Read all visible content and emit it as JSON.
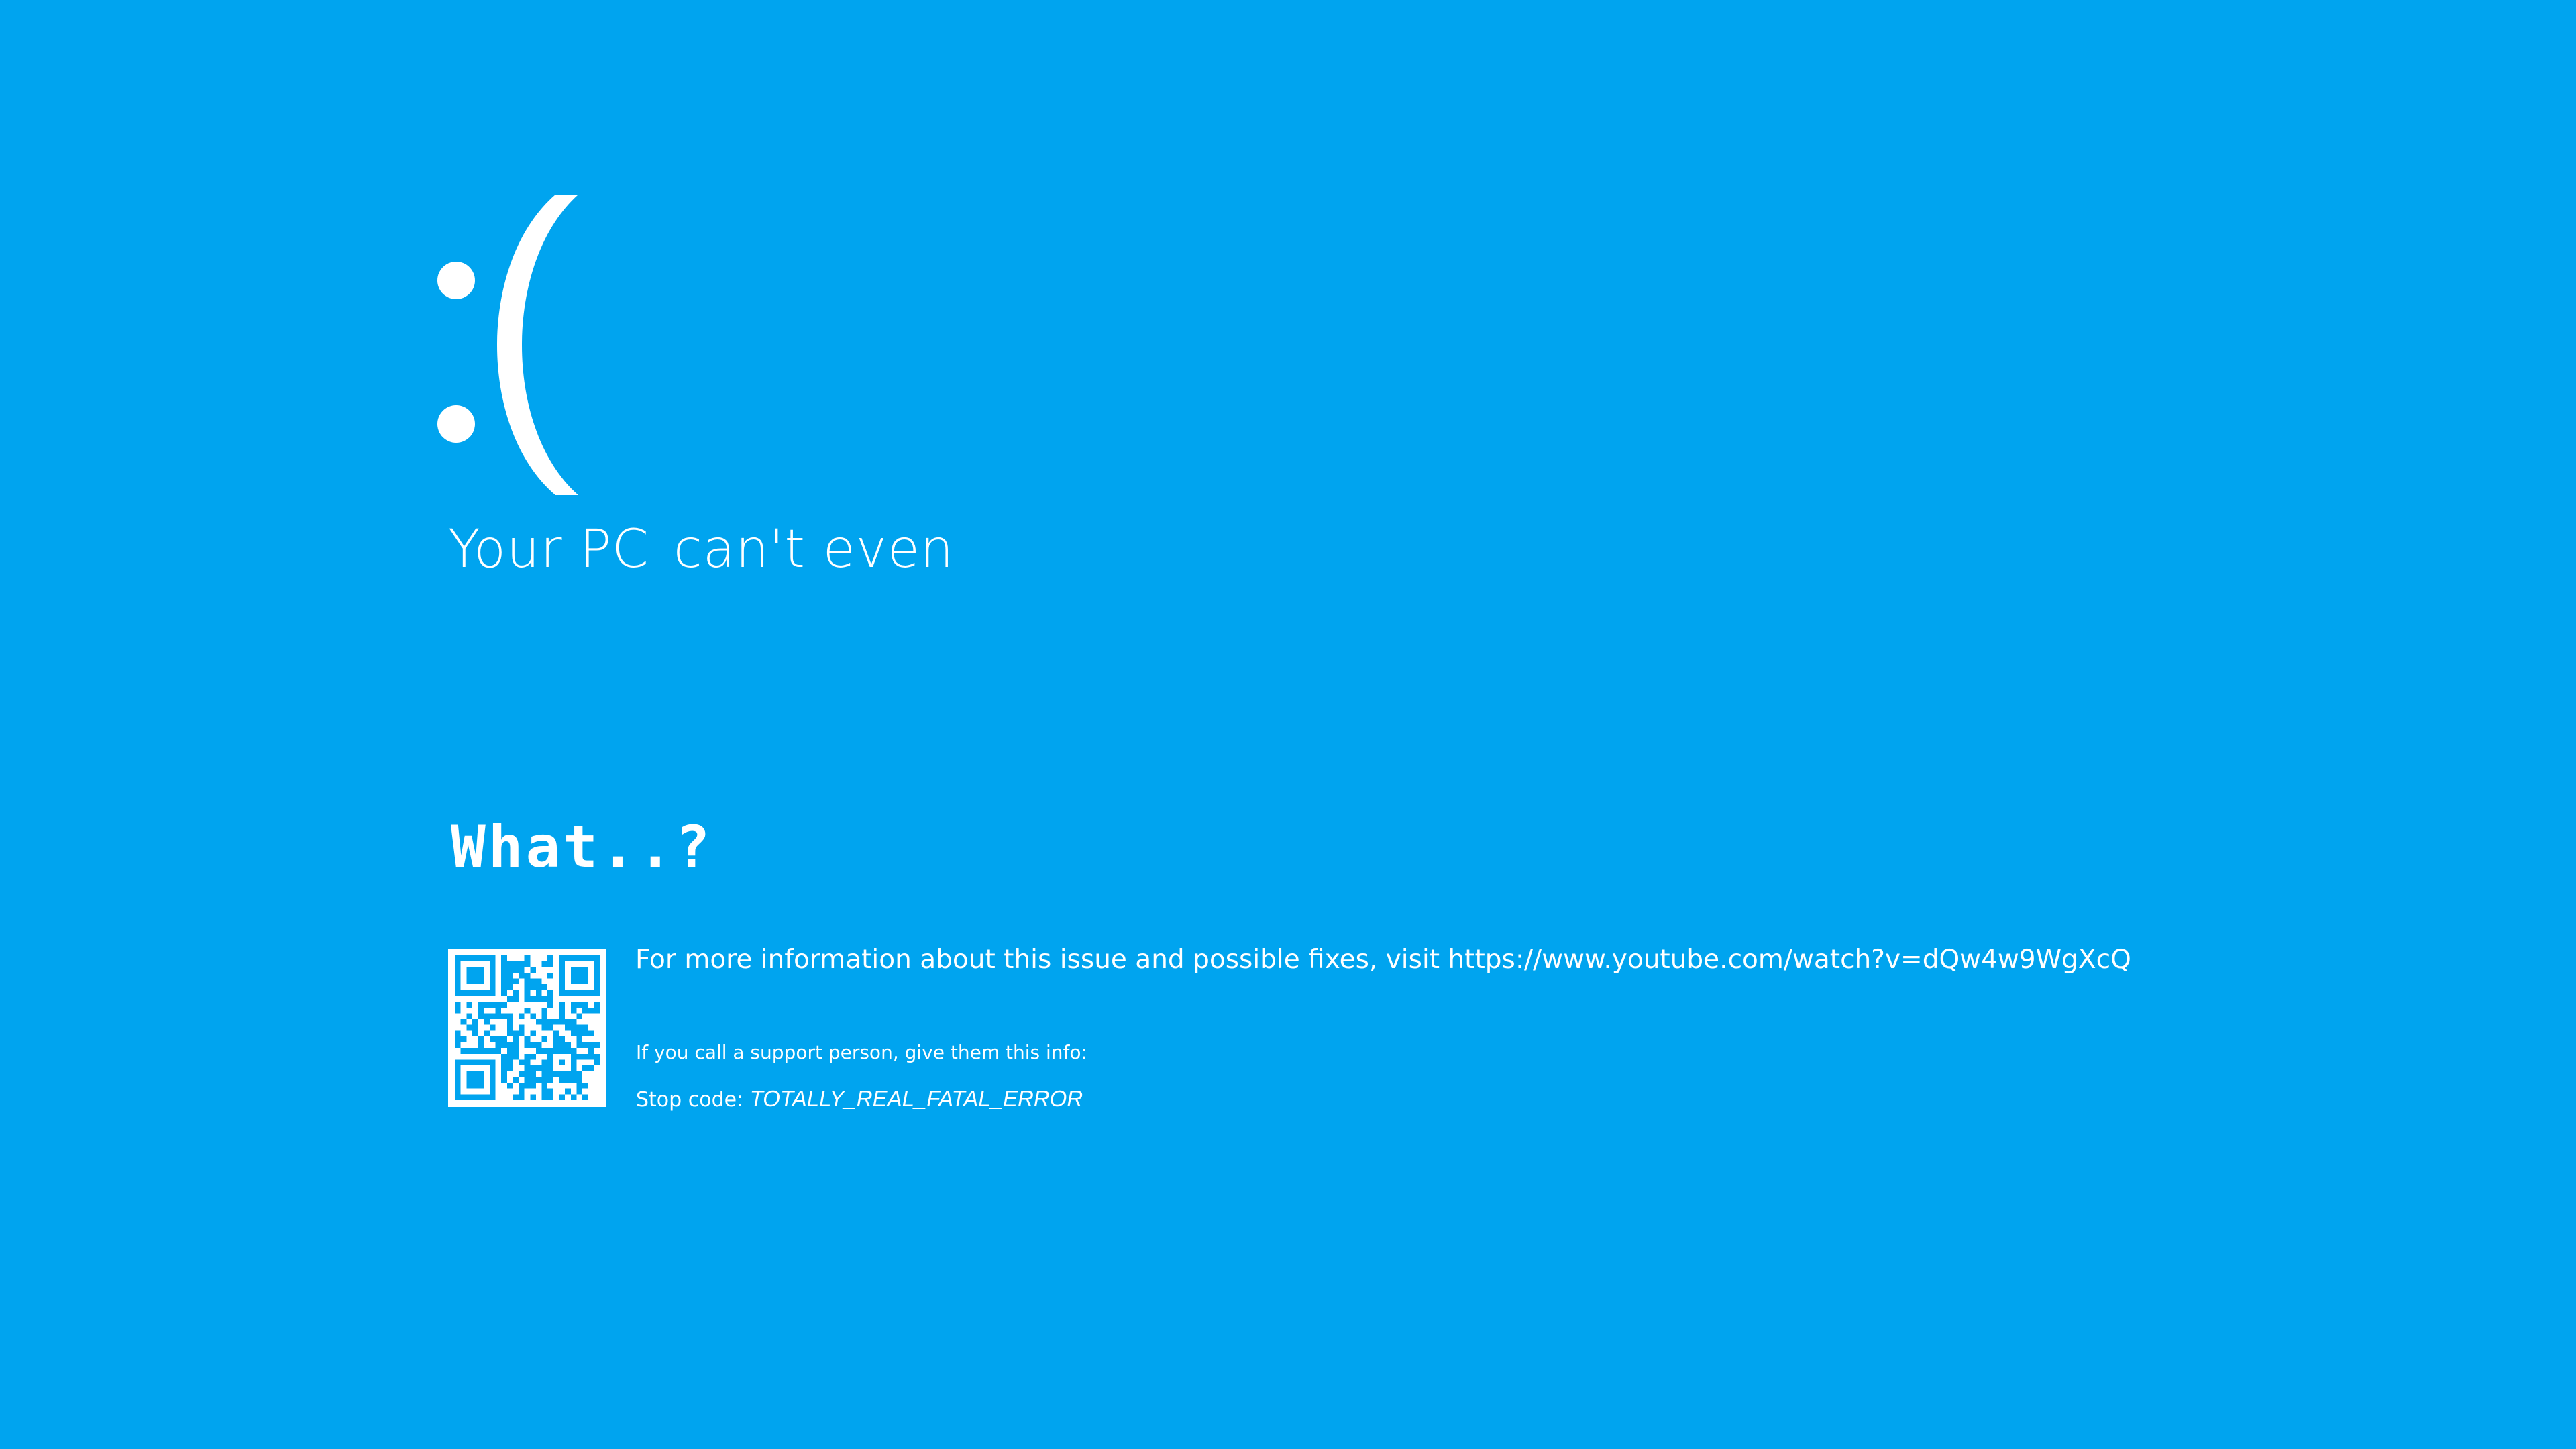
{
  "screen": {
    "background_color": "#00a4ef",
    "text_color": "#ffffff"
  },
  "face": {
    "icon": "sad-face-emoticon",
    "text": ":("
  },
  "headline": {
    "part1": "Your PC",
    "part2": "can't even"
  },
  "subtitle": "What..?",
  "info": {
    "main_text": "For more information about this issue and possible fixes, visit https://www.youtube.com/watch?v=dQw4w9WgXcQ",
    "support_text": "If you call a support person, give them this info:",
    "stop_code_label": "Stop code:",
    "stop_code_value": "TOTALLY_REAL_FATAL_ERROR"
  },
  "qr_code": {
    "icon": "qr-code-icon",
    "fg_color": "#00a4ef",
    "bg_color": "#ffffff"
  }
}
